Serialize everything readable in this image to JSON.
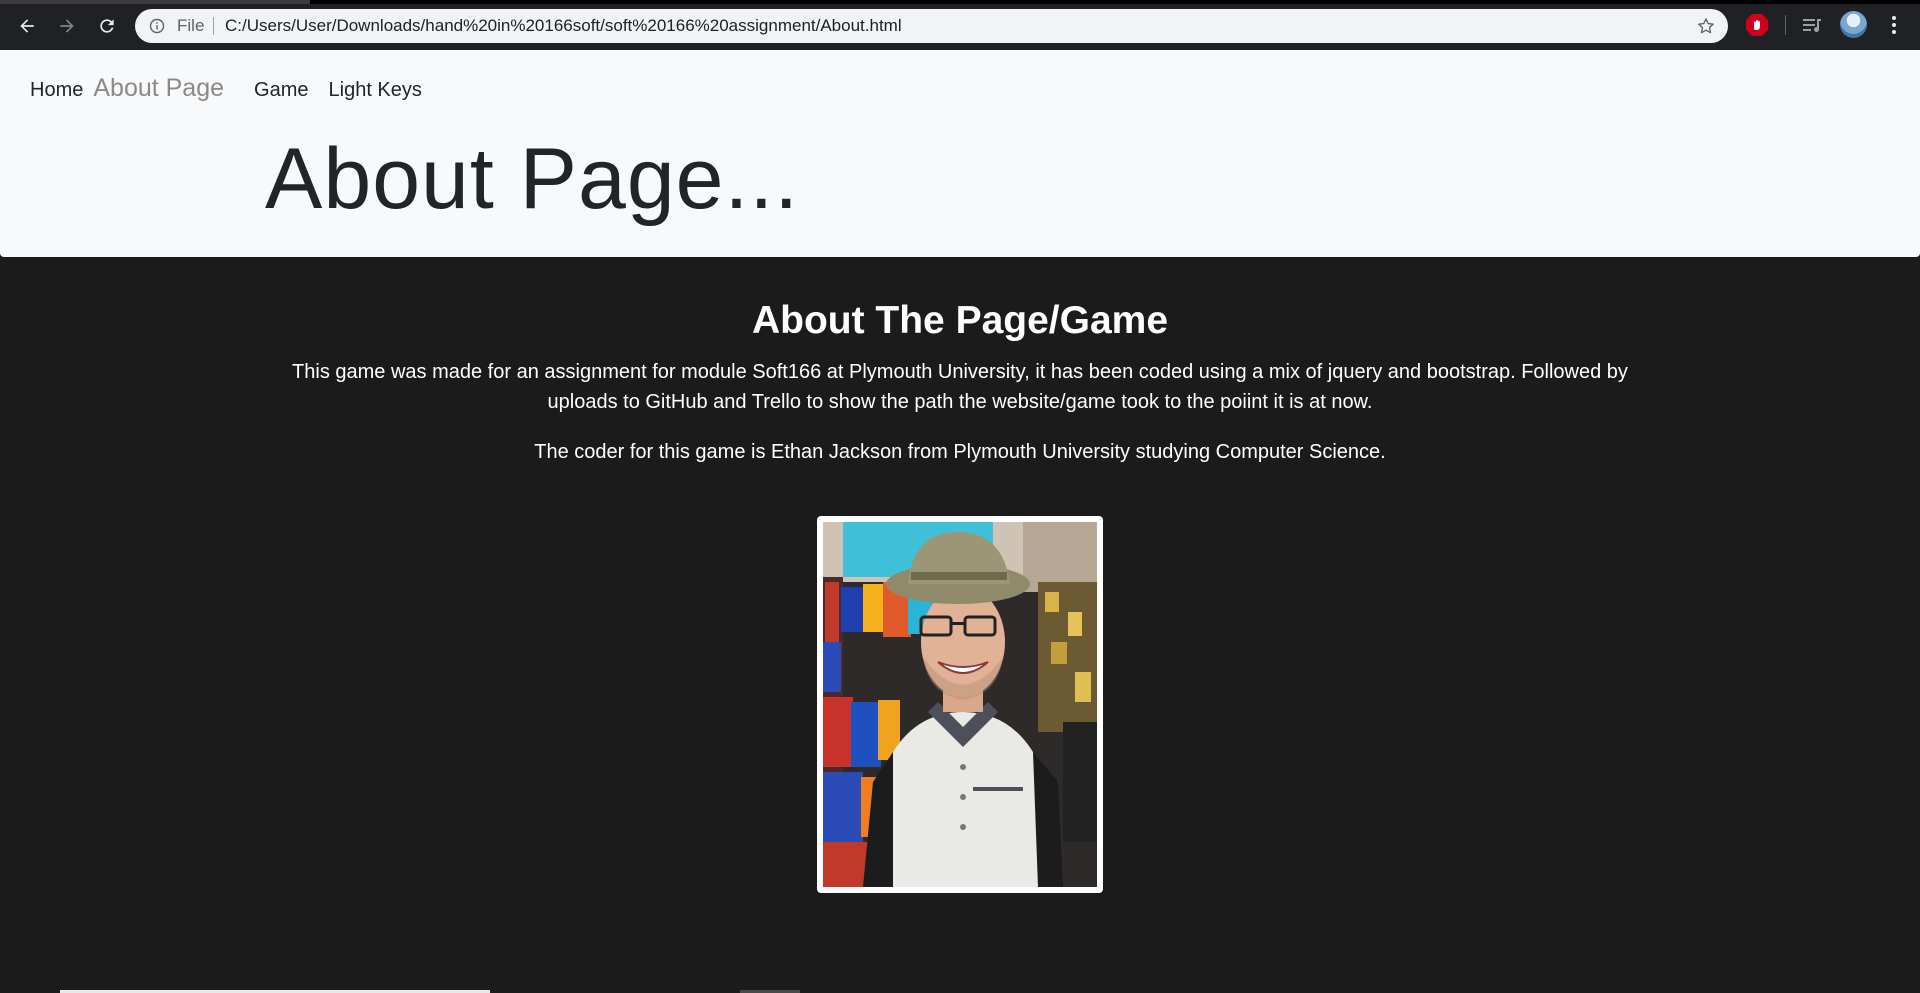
{
  "browser": {
    "omnibox_scheme_label": "File",
    "omnibox_url": "C:/Users/User/Downloads/hand%20in%20166soft/soft%20166%20assignment/About.html",
    "icons": [
      "back-icon",
      "forward-icon",
      "reload-icon",
      "info-icon",
      "star-icon",
      "adblock-icon",
      "media-icon",
      "profile-avatar",
      "menu-icon"
    ]
  },
  "nav": {
    "home_label": "Home",
    "brand_label": "About Page",
    "game_label": "Game",
    "light_keys_label": "Light Keys"
  },
  "hero": {
    "title": "About Page..."
  },
  "content": {
    "section_title": "About The Page/Game",
    "paragraph_1": "This game was made for an assignment for module Soft166 at Plymouth University, it has been coded using a mix of jquery and bootstrap. Followed by uploads to GitHub and Trello to show the path the website/game took to the poiint it is at now.",
    "paragraph_2": "The coder for this game is Ethan Jackson from Plymouth University studying Computer Science."
  },
  "colors": {
    "header_bg": "#f8f9fa",
    "page_bg": "#1b1b1b",
    "brand_text": "#8a8a8a",
    "chrome_bg": "#202124"
  }
}
